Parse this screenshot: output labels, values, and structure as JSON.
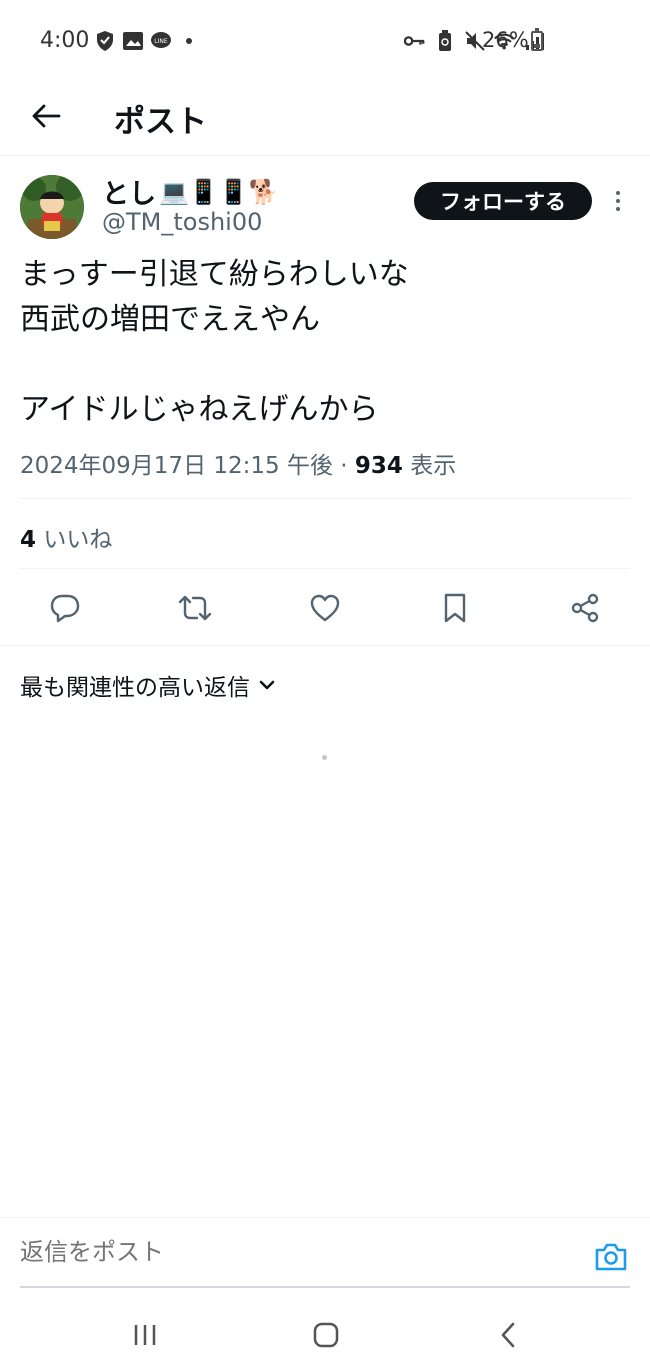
{
  "status_bar": {
    "time": "4:00",
    "battery": "26%",
    "battery_level": 0.26
  },
  "header": {
    "title": "ポスト"
  },
  "post": {
    "display_name": "とし",
    "display_emojis": "💻📱📱🐕",
    "handle": "@TM_toshi00",
    "follow_label": "フォローする",
    "text": "まっすー引退て紛らわしいな\n西武の増田でええやん\n\nアイドルじゃねえげんから",
    "timestamp": "2024年09月17日 12:15 午後",
    "separator": "·",
    "views_count": "934",
    "views_label": "表示",
    "likes_count": "4",
    "likes_label": "いいね"
  },
  "replies": {
    "sort_label": "最も関連性の高い返信"
  },
  "reply_bar": {
    "placeholder": "返信をポスト"
  },
  "colors": {
    "text_primary": "#0f1419",
    "text_secondary": "#536471",
    "accent": "#1d9bf0",
    "divider": "#eff3f4"
  }
}
